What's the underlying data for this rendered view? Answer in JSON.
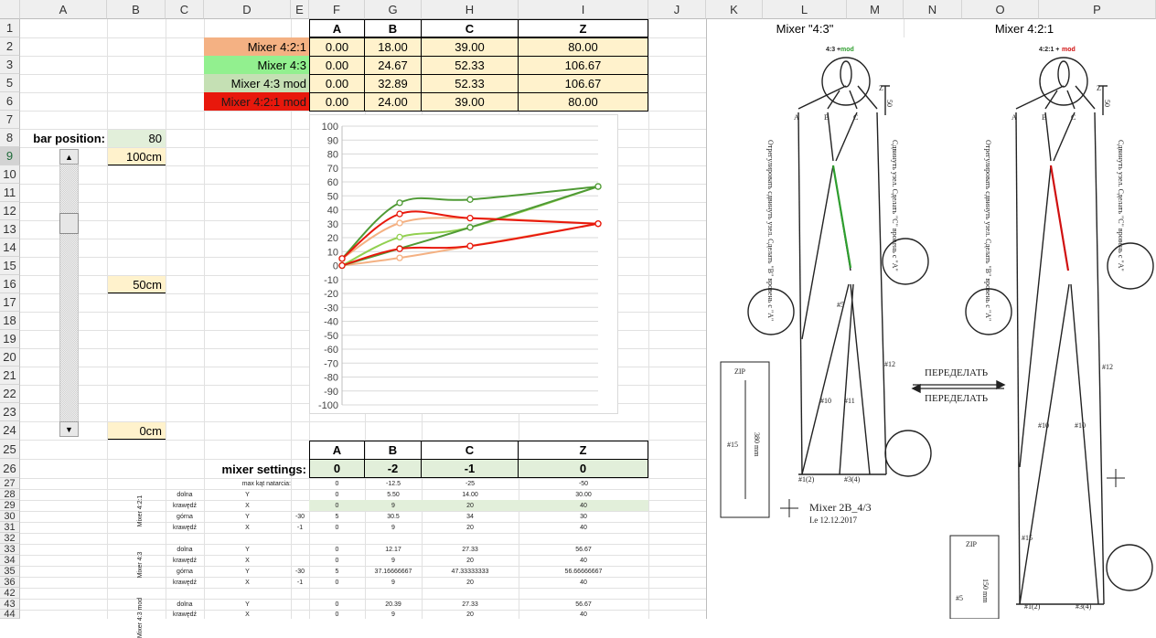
{
  "columns": [
    "A",
    "B",
    "C",
    "D",
    "E",
    "F",
    "G",
    "H",
    "I",
    "J",
    "K",
    "L",
    "M",
    "N",
    "O",
    "P"
  ],
  "rows": [
    "1",
    "2",
    "3",
    "5",
    "6",
    "7",
    "8",
    "9",
    "10",
    "11",
    "12",
    "13",
    "14",
    "15",
    "16",
    "17",
    "18",
    "19",
    "20",
    "21",
    "22",
    "23",
    "24",
    "25",
    "26",
    "27",
    "28",
    "29",
    "30",
    "31",
    "32",
    "33",
    "34",
    "35",
    "36",
    "42",
    "43",
    "44"
  ],
  "header_row": {
    "a": "A",
    "b": "B",
    "c": "C",
    "z": "Z"
  },
  "mixers": [
    {
      "name": "Mixer 4:2:1",
      "color": "#f4b183",
      "a": "0.00",
      "b": "18.00",
      "c": "39.00",
      "z": "80.00"
    },
    {
      "name": "Mixer 4:3",
      "color": "#92f08f",
      "a": "0.00",
      "b": "24.67",
      "c": "52.33",
      "z": "106.67"
    },
    {
      "name": "Mixer 4:3 mod",
      "color": "#c5e0b4",
      "a": "0.00",
      "b": "32.89",
      "c": "52.33",
      "z": "106.67"
    },
    {
      "name": "Mixer 4:2:1 mod",
      "color": "#e8180c",
      "a": "0.00",
      "b": "24.00",
      "c": "39.00",
      "z": "80.00"
    }
  ],
  "bar": {
    "label": "bar position:",
    "value": "80",
    "top": "100cm",
    "mid": "50cm",
    "bottom": "0cm"
  },
  "settings": {
    "label": "mixer settings:",
    "a": "0",
    "b": "-2",
    "c": "-1",
    "z": "0"
  },
  "details": {
    "max_label": "max kąt natarcia:",
    "max": [
      "0",
      "-12.5",
      "-25",
      "-50"
    ],
    "g1": "Mixer 4:2:1",
    "g2": "Mixer 4:3",
    "g3": "Mixer 4:3 mod",
    "r28": [
      "dolna",
      "Y",
      "",
      "0",
      "5.50",
      "14.00",
      "30.00"
    ],
    "r29": [
      "krawędź",
      "X",
      "",
      "0",
      "9",
      "20",
      "40"
    ],
    "r30": [
      "górna",
      "Y",
      "-30",
      "5",
      "30.5",
      "34",
      "30"
    ],
    "r31": [
      "krawędź",
      "X",
      "-1",
      "0",
      "9",
      "20",
      "40"
    ],
    "r33": [
      "dolna",
      "Y",
      "",
      "0",
      "12.17",
      "27.33",
      "56.67"
    ],
    "r34": [
      "krawędź",
      "X",
      "",
      "0",
      "9",
      "20",
      "40"
    ],
    "r35": [
      "górna",
      "Y",
      "-30",
      "5",
      "37.16666667",
      "47.33333333",
      "56.66666667"
    ],
    "r36": [
      "krawędź",
      "X",
      "-1",
      "0",
      "9",
      "20",
      "40"
    ],
    "r43": [
      "dolna",
      "Y",
      "",
      "0",
      "20.39",
      "27.33",
      "56.67"
    ],
    "r44": [
      "krawędź",
      "X",
      "",
      "0",
      "9",
      "20",
      "40"
    ]
  },
  "right_panel": {
    "title_left": "Mixer \"4:3\"",
    "title_right": "Mixer 4:2:1",
    "mod_left_a": "4:3 +",
    "mod_left_b": "mod",
    "mod_right_a": "4:2:1 +",
    "mod_right_b": "mod",
    "zip": "ZIP",
    "zip_dim": "380 mm",
    "zip_dim2": "150 mm",
    "remake1": "ПЕРЕДЕЛАТЬ",
    "remake2": "ПЕРЕДЕЛАТЬ",
    "caption": "Mixer 2B_4/3",
    "date": "I.e  12.12.2017",
    "labels": {
      "a": "A",
      "b": "B",
      "c": "C",
      "z": "Z",
      "n50": "50",
      "l10": "#10",
      "l11": "#11",
      "l12": "#12",
      "l15": "#15",
      "l5": "#5",
      "l12b": "#1(2)",
      "l34": "#3(4)"
    },
    "note_left": "Отрегулировать сдвинуть узел. Сделать \"B\" вровень с \"A\"",
    "note_right": "Сдвинуть узел. Сделать \"C\" вровень с \"A\""
  },
  "chart_data": {
    "type": "line",
    "ylim": [
      -100,
      100
    ],
    "yticks": [
      "100",
      "90",
      "80",
      "70",
      "60",
      "50",
      "40",
      "30",
      "20",
      "10",
      "0",
      "-10",
      "-20",
      "-30",
      "-40",
      "-50",
      "-60",
      "-70",
      "-80",
      "-90",
      "-100"
    ],
    "series": [
      {
        "color": "#f4b183",
        "x": [
          0,
          9,
          20,
          40
        ],
        "y": [
          0,
          5.5,
          14,
          30
        ]
      },
      {
        "color": "#f4b183",
        "x": [
          0,
          9,
          20,
          40
        ],
        "y": [
          5,
          30.5,
          34,
          30
        ]
      },
      {
        "color": "#92d050",
        "x": [
          0,
          9,
          20,
          40
        ],
        "y": [
          0,
          20.39,
          27.33,
          56.67
        ]
      },
      {
        "color": "#4f9a35",
        "x": [
          0,
          9,
          20,
          40
        ],
        "y": [
          0,
          12.17,
          27.33,
          56.67
        ]
      },
      {
        "color": "#4f9a35",
        "x": [
          0,
          9,
          20,
          40
        ],
        "y": [
          5,
          45,
          47.33,
          56.67
        ]
      },
      {
        "color": "#e8180c",
        "x": [
          0,
          9,
          20,
          40
        ],
        "y": [
          0,
          12,
          14,
          30
        ]
      },
      {
        "color": "#e8180c",
        "x": [
          0,
          9,
          20,
          40
        ],
        "y": [
          5,
          37,
          34,
          30
        ]
      }
    ]
  }
}
